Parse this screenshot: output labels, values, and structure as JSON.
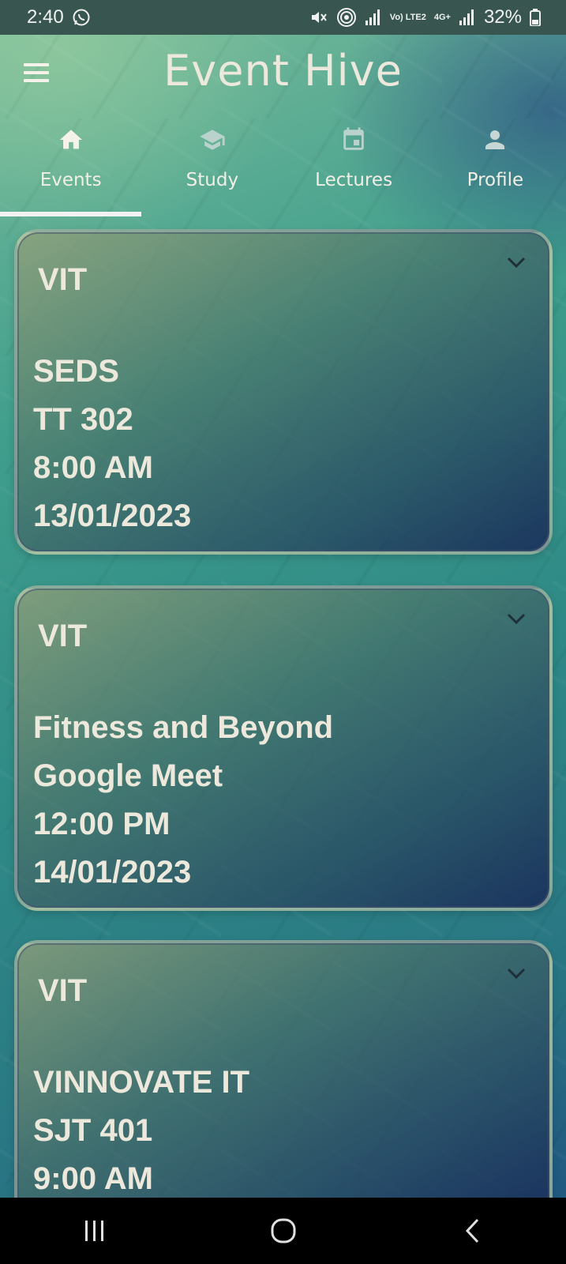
{
  "status_bar": {
    "time": "2:40",
    "network_small_text": "Vo) LTE2",
    "network_type": "4G+",
    "battery": "32%"
  },
  "app": {
    "title": "Event Hive"
  },
  "tabs": [
    {
      "label": "Events",
      "icon": "home-icon",
      "active": true
    },
    {
      "label": "Study",
      "icon": "graduation-cap-icon",
      "active": false
    },
    {
      "label": "Lectures",
      "icon": "calendar-event-icon",
      "active": false
    },
    {
      "label": "Profile",
      "icon": "person-icon",
      "active": false
    }
  ],
  "events": [
    {
      "org": "VIT",
      "name": "SEDS",
      "venue": "TT 302",
      "time": "8:00 AM",
      "date": "13/01/2023"
    },
    {
      "org": "VIT",
      "name": "Fitness and Beyond",
      "venue": "Google Meet",
      "time": "12:00 PM",
      "date": "14/01/2023"
    },
    {
      "org": "VIT",
      "name": "VINNOVATE IT",
      "venue": "SJT 401",
      "time": "9:00 AM",
      "date": ""
    }
  ],
  "colors": {
    "text": "#ece8dc",
    "status_bar_bg": "#38564f",
    "nav_bar_bg": "#000000",
    "tab_indicator": "#f2f2f2"
  }
}
